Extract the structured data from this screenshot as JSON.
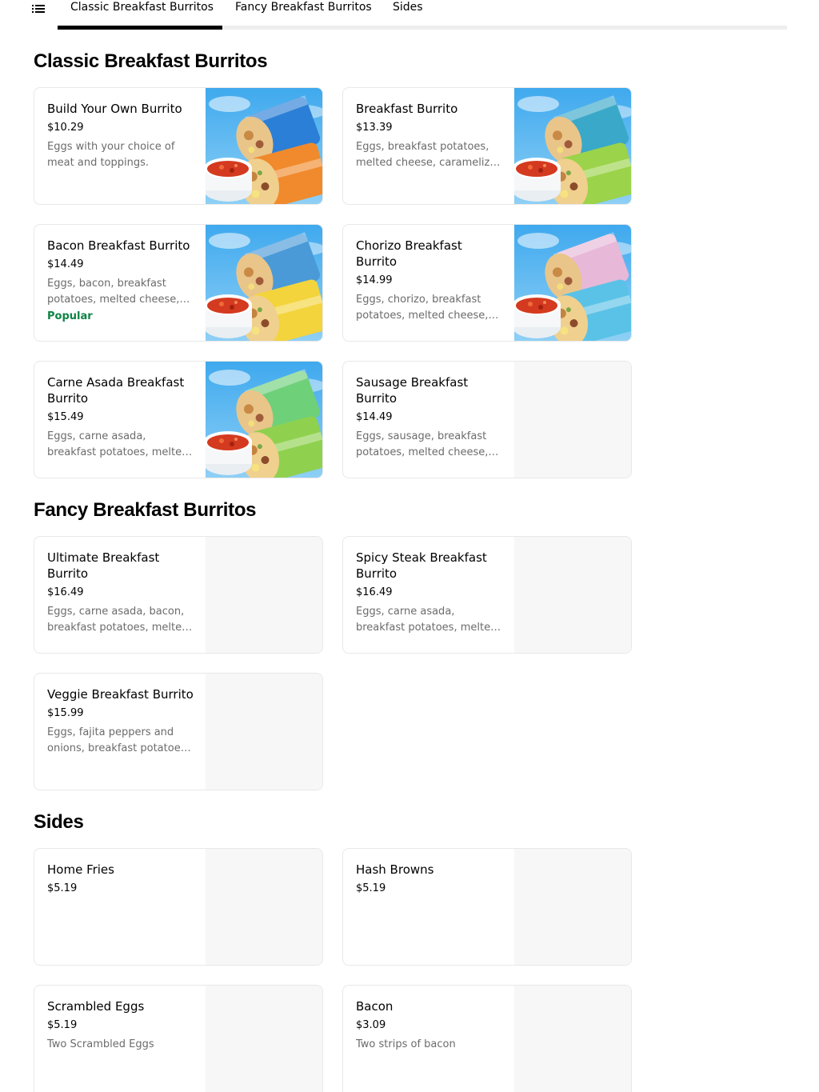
{
  "nav": {
    "menu_icon": "list-menu-icon",
    "tabs": [
      {
        "label": "Classic Breakfast Burritos",
        "active": true
      },
      {
        "label": "Fancy Breakfast Burritos",
        "active": false
      },
      {
        "label": "Sides",
        "active": false
      }
    ]
  },
  "sections": [
    {
      "title": "Classic Breakfast Burritos",
      "items": [
        {
          "name": "Build Your Own Burrito",
          "price": "$10.29",
          "description": "Eggs with your choice of meat and toppings.",
          "badge": "",
          "wrap_colors": [
            "#f08a2c",
            "#2b7fd6"
          ]
        },
        {
          "name": "Breakfast Burrito",
          "price": "$13.39",
          "description": "Eggs, breakfast potatoes, melted cheese, caramelized onions",
          "badge": "",
          "wrap_colors": [
            "#9bd34a",
            "#3aa8c9"
          ]
        },
        {
          "name": "Bacon Breakfast Burrito",
          "price": "$14.49",
          "description": "Eggs, bacon, breakfast potatoes, melted cheese, caramelized onions",
          "badge": "Popular",
          "wrap_colors": [
            "#f3d43c",
            "#4a9ad8"
          ]
        },
        {
          "name": "Chorizo Breakfast Burrito",
          "price": "$14.99",
          "description": "Eggs, chorizo, breakfast potatoes, melted cheese, caramelized onions",
          "badge": "",
          "wrap_colors": [
            "#5bc2e7",
            "#e7b8d8"
          ]
        },
        {
          "name": "Carne Asada Breakfast Burrito",
          "price": "$15.49",
          "description": "Eggs, carne asada, breakfast potatoes, melted cheese, caramelized onions",
          "badge": "",
          "wrap_colors": [
            "#8fd14f",
            "#6fd07a"
          ]
        },
        {
          "name": "Sausage Breakfast Burrito",
          "price": "$14.49",
          "description": "Eggs, sausage, breakfast potatoes, melted cheese, caramelized onions",
          "badge": "",
          "wrap_colors": []
        }
      ]
    },
    {
      "title": "Fancy Breakfast Burritos",
      "items": [
        {
          "name": "Ultimate Breakfast Burrito",
          "price": "$16.49",
          "description": "Eggs, carne asada, bacon, breakfast potatoes, melted cheese",
          "badge": "",
          "wrap_colors": []
        },
        {
          "name": "Spicy Steak Breakfast Burrito",
          "price": "$16.49",
          "description": "Eggs, carne asada, breakfast potatoes, melted cheese, jalapeños",
          "badge": "",
          "wrap_colors": []
        },
        {
          "name": "Veggie Breakfast Burrito",
          "price": "$15.99",
          "description": "Eggs, fajita peppers and onions, breakfast potatoes, melted cheese",
          "badge": "",
          "wrap_colors": []
        }
      ]
    },
    {
      "title": "Sides",
      "items": [
        {
          "name": "Home Fries",
          "price": "$5.19",
          "description": "",
          "badge": "",
          "wrap_colors": []
        },
        {
          "name": "Hash Browns",
          "price": "$5.19",
          "description": "",
          "badge": "",
          "wrap_colors": []
        },
        {
          "name": "Scrambled Eggs",
          "price": "$5.19",
          "description": "Two Scrambled Eggs",
          "badge": "",
          "wrap_colors": []
        },
        {
          "name": "Bacon",
          "price": "$3.09",
          "description": "Two strips of bacon",
          "badge": "",
          "wrap_colors": []
        }
      ]
    }
  ],
  "colors": {
    "accent": "#000000",
    "popular_badge": "#0e8345",
    "description_text": "#6b6b6b",
    "sky_photo_background": "#4cb4f0"
  }
}
